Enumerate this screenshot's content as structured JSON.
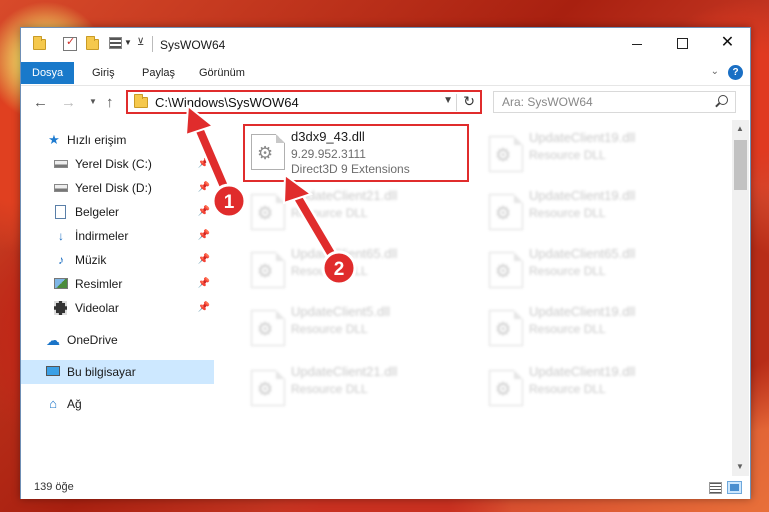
{
  "titlebar": {
    "title": "SysWOW64",
    "minimize_glyph": "",
    "maximize_glyph": "",
    "close_glyph": "✕"
  },
  "ribbon": {
    "tabs": [
      "Dosya",
      "Giriş",
      "Paylaş",
      "Görünüm"
    ],
    "active_tab": "Dosya",
    "help_glyph": "?"
  },
  "nav": {
    "address": "C:\\Windows\\SysWOW64",
    "search_placeholder": "Ara: SysWOW64"
  },
  "sidebar": {
    "items": [
      {
        "label": "Hızlı erişim",
        "icon": "star-icon",
        "pinned": false
      },
      {
        "label": "Yerel Disk (C:)",
        "icon": "drive-icon",
        "pinned": true
      },
      {
        "label": "Yerel Disk (D:)",
        "icon": "drive-icon",
        "pinned": true
      },
      {
        "label": "Belgeler",
        "icon": "documents-icon",
        "pinned": true
      },
      {
        "label": "İndirmeler",
        "icon": "download-icon",
        "pinned": true
      },
      {
        "label": "Müzik",
        "icon": "music-icon",
        "pinned": true
      },
      {
        "label": "Resimler",
        "icon": "pictures-icon",
        "pinned": true
      },
      {
        "label": "Videolar",
        "icon": "videos-icon",
        "pinned": true
      },
      {
        "label": "OneDrive",
        "icon": "cloud-icon",
        "pinned": false
      },
      {
        "label": "Bu bilgisayar",
        "icon": "computer-icon",
        "pinned": false,
        "selected": true
      },
      {
        "label": "Ağ",
        "icon": "network-icon",
        "pinned": false
      }
    ]
  },
  "files": [
    {
      "name": "d3dx9_43.dll",
      "version": "9.29.952.3111",
      "description": "Direct3D 9 Extensions",
      "highlighted": true
    },
    {
      "name": "UpdateClient19.dll",
      "version": "Resource DLL",
      "blurred": true
    },
    {
      "name": "UpdateClient21.dll",
      "version": "Resource DLL",
      "blurred": true
    },
    {
      "name": "UpdateClient19.dll",
      "version": "Resource DLL",
      "blurred": true
    },
    {
      "name": "UpdateClient65.dll",
      "version": "Resource DLL",
      "blurred": true
    },
    {
      "name": "UpdateClient65.dll",
      "version": "Resource DLL",
      "blurred": true
    },
    {
      "name": "UpdateClient5.dll",
      "version": "Resource DLL",
      "blurred": true
    },
    {
      "name": "UpdateClient19.dll",
      "version": "Resource DLL",
      "blurred": true
    },
    {
      "name": "UpdateClient21.dll",
      "version": "Resource DLL",
      "blurred": true
    },
    {
      "name": "UpdateClient19.dll",
      "version": "Resource DLL",
      "blurred": true
    }
  ],
  "status": {
    "item_count": "139 öğe"
  },
  "annotations": {
    "badge_1": "1",
    "badge_2": "2",
    "color": "#e02c2c"
  }
}
